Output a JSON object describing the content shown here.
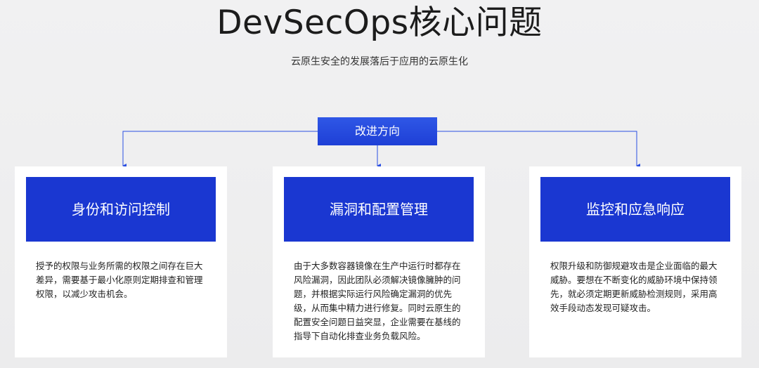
{
  "title": "DevSecOps核心问题",
  "subtitle": "云原生安全的发展落后于应用的云原生化",
  "center_node": {
    "label": "改进方向"
  },
  "cards": [
    {
      "title": "身份和访问控制",
      "description": "授予的权限与业务所需的权限之间存在巨大差异，需要基于最小化原则定期排查和管理权限，以减少攻击机会。"
    },
    {
      "title": "漏洞和配置管理",
      "description": "由于大多数容器镜像在生产中运行时都存在风险漏洞，因此团队必须解决镜像臃肿的问题，并根据实际运行风险确定漏洞的优先级，从而集中精力进行修复。同时云原生的配置安全问题日益突显，企业需要在基线的指导下自动化排查业务负载风险。"
    },
    {
      "title": "监控和应急响应",
      "description": "权限升级和防御规避攻击是企业面临的最大威胁。要想在不断变化的威胁环境中保持领先，就必须定期更新威胁检测规则，采用高效手段动态发现可疑攻击。"
    }
  ],
  "colors": {
    "accent_blue": "#1a37d1",
    "center_blue": "#2a4fe2",
    "connector": "#2a4fe2",
    "background": "#efeff0"
  }
}
